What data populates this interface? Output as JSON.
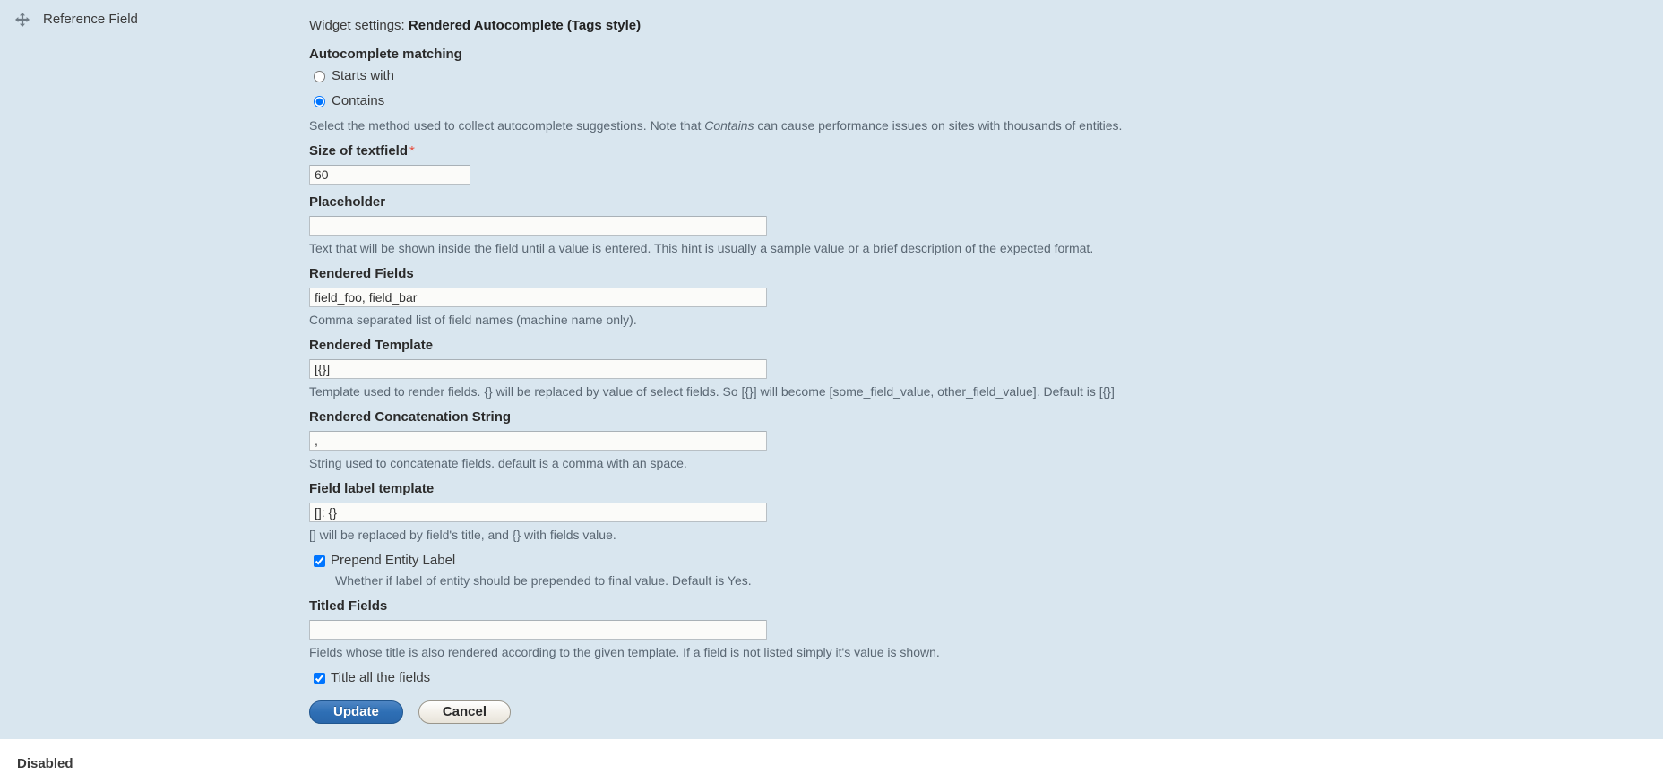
{
  "field_row": {
    "drag_handle_icon": "move-cross-icon",
    "label": "Reference Field"
  },
  "widget_settings": {
    "prefix": "Widget settings:",
    "widget_name": "Rendered Autocomplete (Tags style)",
    "autocomplete_matching": {
      "legend": "Autocomplete matching",
      "options": [
        {
          "label": "Starts with",
          "value": "starts_with",
          "selected": false
        },
        {
          "label": "Contains",
          "value": "contains",
          "selected": true
        }
      ],
      "description_parts": {
        "before": "Select the method used to collect autocomplete suggestions. Note that ",
        "emphasis": "Contains",
        "after": " can cause performance issues on sites with thousands of entities."
      }
    },
    "fields": [
      {
        "label": "Size of textfield",
        "required": true,
        "value": "60",
        "placeholder": "",
        "description": ""
      },
      {
        "label": "Placeholder",
        "required": false,
        "value": "",
        "placeholder": "",
        "description": "Text that will be shown inside the field until a value is entered. This hint is usually a sample value or a brief description of the expected format."
      },
      {
        "label": "Rendered Fields",
        "required": false,
        "value": "field_foo, field_bar",
        "placeholder": "",
        "description": "Comma separated list of field names (machine name only)."
      },
      {
        "label": "Rendered Template",
        "required": false,
        "value": "[{}]",
        "placeholder": "",
        "description": "Template used to render fields. {} will be replaced by value of select fields. So [{}] will become [some_field_value, other_field_value]. Default is [{}]"
      },
      {
        "label": "Rendered Concatenation String",
        "required": false,
        "value": ", ",
        "placeholder": "",
        "description": "String used to concatenate fields. default is a comma with an space."
      },
      {
        "label": "Field label template",
        "required": false,
        "value": "[]: {}",
        "placeholder": "",
        "description": "[] will be replaced by field's title, and {} with fields value."
      }
    ],
    "prepend_entity_label": {
      "label": "Prepend Entity Label",
      "checked": true,
      "description": "Whether if label of entity should be prepended to final value. Default is Yes."
    },
    "titled_fields": {
      "label": "Titled Fields",
      "value": "",
      "placeholder": "",
      "description": "Fields whose title is also rendered according to the given template. If a field is not listed simply it's value is shown."
    },
    "title_all_fields": {
      "label": "Title all the fields",
      "checked": true
    },
    "actions": {
      "update_label": "Update",
      "cancel_label": "Cancel"
    }
  },
  "bottom": {
    "disabled_label": "Disabled"
  },
  "colors": {
    "region_background": "#d9e6ef",
    "primary_button": "#2e6fb5",
    "required_marker": "#e74c3c",
    "description_text": "#5a6773"
  }
}
